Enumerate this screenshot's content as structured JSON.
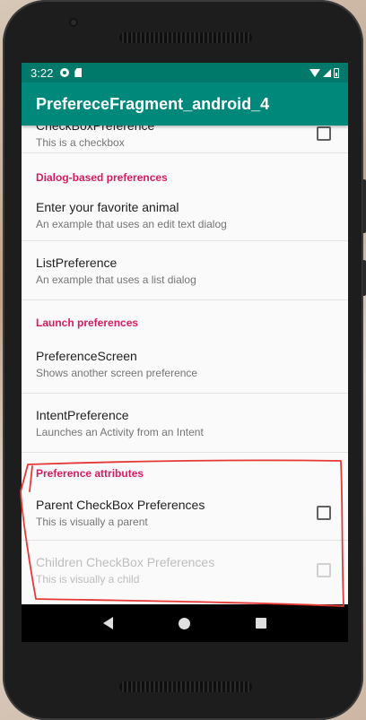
{
  "status_bar": {
    "time": "3:22"
  },
  "app_bar": {
    "title": "PrefereceFragment_android_4"
  },
  "preferences": {
    "checkbox_pref": {
      "title": "CheckBoxPreference",
      "summary": "This is a checkbox",
      "checked": false
    },
    "dialog_category": "Dialog-based preferences",
    "edit_text_pref": {
      "title": "Enter your favorite animal",
      "summary": "An example that uses an edit text dialog"
    },
    "list_pref": {
      "title": "ListPreference",
      "summary": "An example that uses a list dialog"
    },
    "launch_category": "Launch preferences",
    "screen_pref": {
      "title": "PreferenceScreen",
      "summary": "Shows another screen preference"
    },
    "intent_pref": {
      "title": "IntentPreference",
      "summary": "Launches an Activity from an Intent"
    },
    "attributes_category": "Preference attributes",
    "parent_checkbox": {
      "title": "Parent CheckBox Preferences",
      "summary": "This is visually a parent",
      "checked": false
    },
    "child_checkbox": {
      "title": "Children CheckBox Preferences",
      "summary": "This is visually a child",
      "checked": false,
      "enabled": false
    }
  },
  "colors": {
    "app_bar": "#00897b",
    "status_bar": "#00796b",
    "category_accent": "#d81b60",
    "annotation": "#e53935"
  },
  "icons": {
    "status_left": [
      "gear-icon",
      "sd-card-icon"
    ],
    "status_right": [
      "wifi-icon",
      "cell-signal-icon",
      "battery-icon"
    ],
    "nav": [
      "back-icon",
      "home-icon",
      "recents-icon"
    ]
  }
}
